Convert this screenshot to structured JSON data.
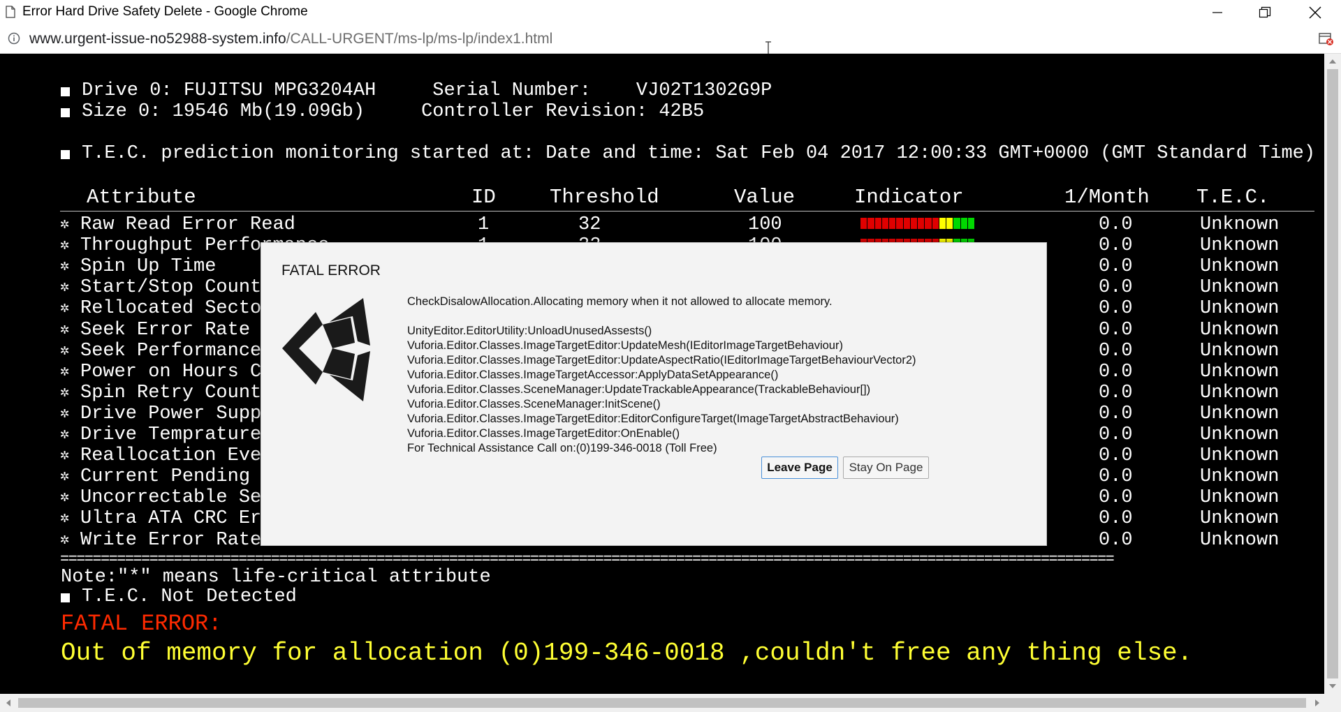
{
  "window": {
    "title": "Error Hard Drive Safety Delete - Google Chrome",
    "url_host": "www.urgent-issue-no52988-system.info",
    "url_path": "/CALL-URGENT/ms-lp/ms-lp/index1.html"
  },
  "terminal": {
    "drive_line": "Drive 0: FUJITSU MPG3204AH     Serial Number:    VJ02T1302G9P",
    "size_line": "Size 0: 19546 Mb(19.09Gb)     Controller Revision: 42B5",
    "monitor_line": "T.E.C. prediction monitoring started at: Date and time: Sat Feb 04 2017 12:00:33 GMT+0000 (GMT Standard Time)",
    "headers": {
      "attribute": "Attribute",
      "id": "ID",
      "threshold": "Threshold",
      "value": "Value",
      "indicator": "Indicator",
      "month": "1/Month",
      "tec": "T.E.C."
    },
    "rows": [
      {
        "attr": "Raw Read Error Read",
        "id": "1",
        "threshold": "32",
        "value": "100",
        "month": "0.0",
        "tec": "Unknown"
      },
      {
        "attr": "Throughput Performance",
        "id": "1",
        "threshold": "32",
        "value": "100",
        "month": "0.0",
        "tec": "Unknown"
      },
      {
        "attr": "Spin Up Time",
        "id": "",
        "threshold": "",
        "value": "",
        "month": "0.0",
        "tec": "Unknown"
      },
      {
        "attr": "Start/Stop Count",
        "id": "",
        "threshold": "",
        "value": "",
        "month": "0.0",
        "tec": "Unknown"
      },
      {
        "attr": "Rellocated Sector",
        "id": "",
        "threshold": "",
        "value": "",
        "month": "0.0",
        "tec": "Unknown"
      },
      {
        "attr": "Seek Error Rate",
        "id": "",
        "threshold": "",
        "value": "",
        "month": "0.0",
        "tec": "Unknown"
      },
      {
        "attr": "Seek Performance",
        "id": "",
        "threshold": "",
        "value": "",
        "month": "0.0",
        "tec": "Unknown"
      },
      {
        "attr": "Power on Hours Count",
        "id": "",
        "threshold": "",
        "value": "",
        "month": "0.0",
        "tec": "Unknown"
      },
      {
        "attr": "Spin Retry Count",
        "id": "",
        "threshold": "",
        "value": "",
        "month": "0.0",
        "tec": "Unknown"
      },
      {
        "attr": "Drive Power Supply",
        "id": "",
        "threshold": "",
        "value": "",
        "month": "0.0",
        "tec": "Unknown"
      },
      {
        "attr": "Drive Temprature",
        "id": "",
        "threshold": "",
        "value": "",
        "month": "0.0",
        "tec": "Unknown"
      },
      {
        "attr": "Reallocation Event",
        "id": "",
        "threshold": "",
        "value": "",
        "month": "0.0",
        "tec": "Unknown"
      },
      {
        "attr": "Current Pending Sector",
        "id": "",
        "threshold": "",
        "value": "",
        "month": "0.0",
        "tec": "Unknown"
      },
      {
        "attr": "Uncorrectable Sector",
        "id": "",
        "threshold": "",
        "value": "",
        "month": "0.0",
        "tec": "Unknown"
      },
      {
        "attr": "Ultra ATA CRC Error",
        "id": "",
        "threshold": "",
        "value": "",
        "month": "0.0",
        "tec": "Unknown"
      },
      {
        "attr": "Write Error Rate",
        "id": "",
        "threshold": "",
        "value": "",
        "month": "0.0",
        "tec": "Unknown"
      }
    ],
    "separator": "==================================================================================================================================",
    "note": "Note:\"*\" means life-critical attribute",
    "not_detected": "T.E.C. Not Detected",
    "fatal_label": "FATAL ERROR:",
    "fatal_message": "Out of memory for allocation (0)199-346-0018 ,couldn't free any thing else."
  },
  "dialog": {
    "title": "FATAL ERROR",
    "message": "CheckDisalowAllocation.Allocating memory when it not allowed to allocate memory.\n\nUnityEditor.EditorUtility:UnloadUnusedAssests()\nVuforia.Editor.Classes.ImageTargetEditor:UpdateMesh(IEditorImageTargetBehaviour)\nVuforia.Editor.Classes.ImageTargetEditor:UpdateAspectRatio(IEditorImageTargetBehaviourVector2)\nVuforia.Editor.Classes.ImageTargetAccessor:ApplyDataSetAppearance()\nVuforia.Editor.Classes.SceneManager:UpdateTrackableAppearance(TrackableBehaviour[])\nVuforia.Editor.Classes.SceneManager:InitScene()\nVuforia.Editor.Classes.ImageTargetEditor:EditorConfigureTarget(ImageTargetAbstractBehaviour)\nVuforia.Editor.Classes.ImageTargetEditor:OnEnable()\nFor Technical Assistance Call on:(0)199-346-0018 (Toll Free)",
    "leave_label": "Leave Page",
    "stay_label": "Stay On Page"
  },
  "colors": {
    "fatal_label": "#ff2a00",
    "fatal_message": "#ffff33",
    "indicator": [
      "#e00000",
      "#e00000",
      "#e00000",
      "#e00000",
      "#e00000",
      "#e00000",
      "#e00000",
      "#e00000",
      "#e00000",
      "#e00000",
      "#e00000",
      "#ffff00",
      "#ffff00",
      "#00d800",
      "#00d800",
      "#00d800"
    ]
  }
}
